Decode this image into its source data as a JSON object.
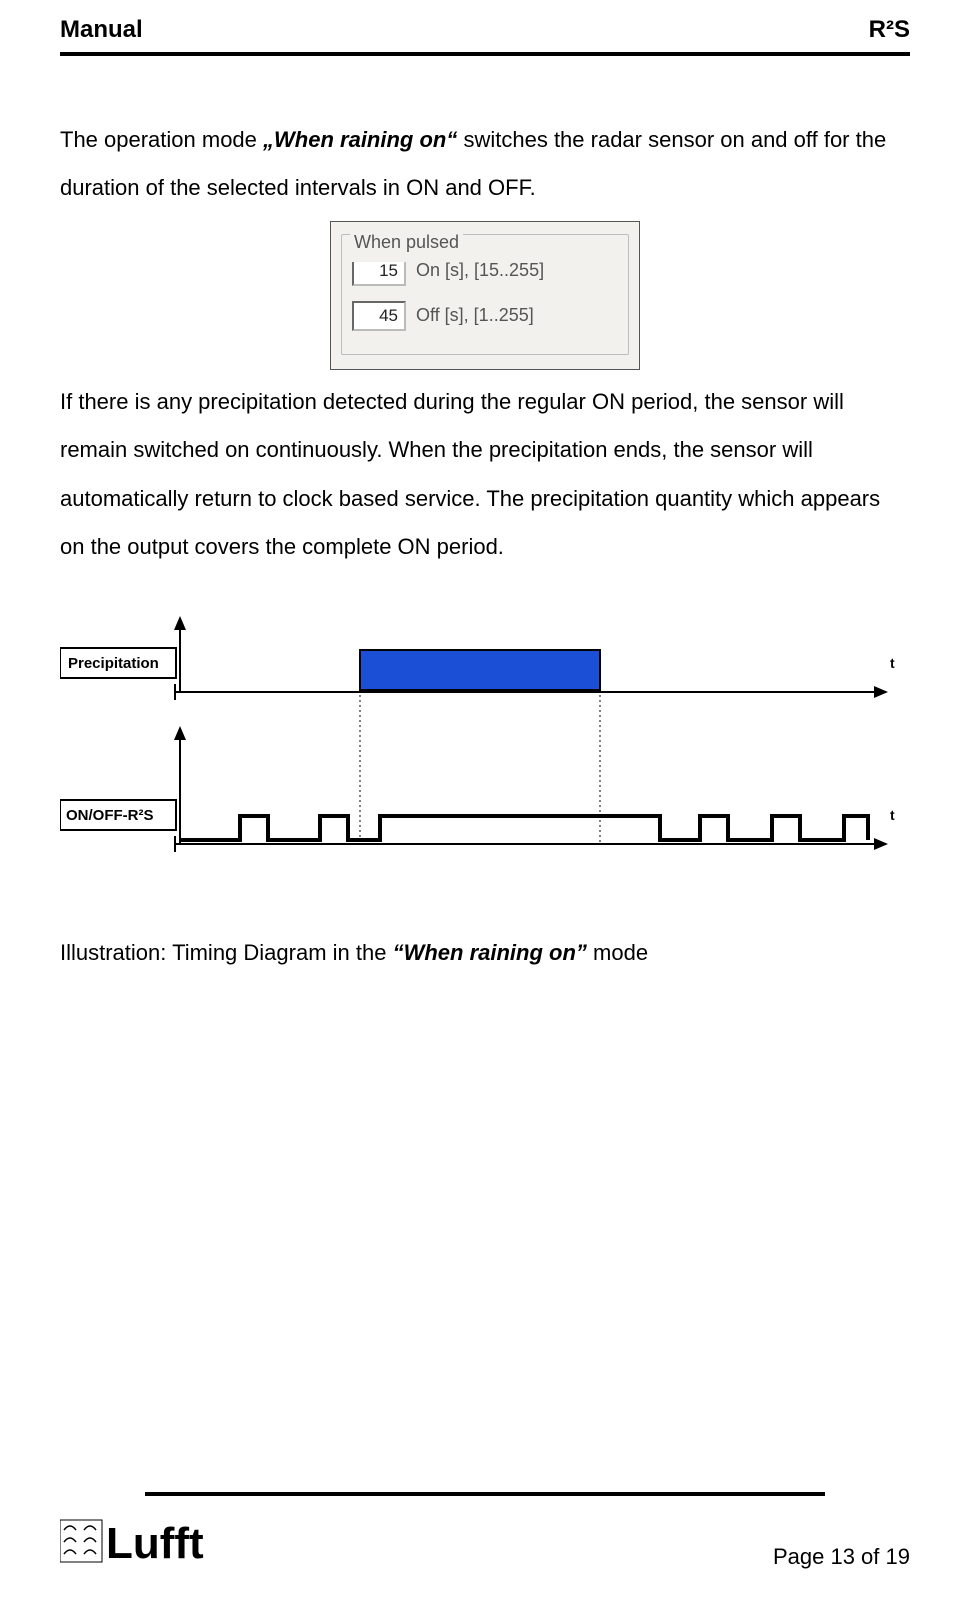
{
  "header": {
    "left": "Manual",
    "right": "R²S"
  },
  "para1": {
    "pre": "The operation mode ",
    "mode": "„When raining on“",
    "post": " switches the radar sensor on and off for the duration of the selected intervals in ON and OFF."
  },
  "dialog": {
    "legend": "When pulsed",
    "on_value": "15",
    "on_label": "On [s], [15..255]",
    "off_value": "45",
    "off_label": "Off [s], [1..255]"
  },
  "para2": "If there is any precipitation detected during the regular ON period, the sensor will remain switched on continuously. When the precipitation ends, the sensor will automatically return to clock based service. The precipitation quantity which appears on the output covers the complete ON period.",
  "diagram": {
    "label_precip": "Precipitation",
    "label_onoff": "ON/OFF-R²S",
    "axis_t": "t"
  },
  "caption": {
    "pre": "Illustration: Timing Diagram in the ",
    "mode": "“When raining on”",
    "post": " mode"
  },
  "footer": {
    "logo_text": "Lufft",
    "page": "Page 13 of 19"
  }
}
